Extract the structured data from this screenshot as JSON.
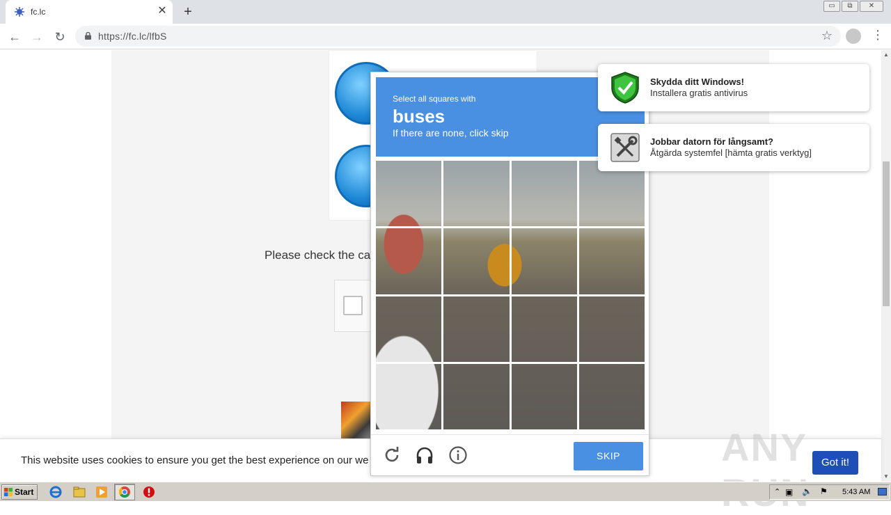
{
  "tab": {
    "title": "fc.lc",
    "close": "✕",
    "new_tab": "+"
  },
  "window": {
    "minimize": "▭",
    "restore": "⧉",
    "close": "✕"
  },
  "toolbar": {
    "url": "https://fc.lc/lfbS"
  },
  "page": {
    "please_text": "Please check the ca",
    "cookie_text": "This website uses cookies to ensure you get the best experience on our we",
    "got_it": "Got it!",
    "watermark": "ANY RUN"
  },
  "captcha": {
    "instruction": "Select all squares with",
    "target": "buses",
    "subtext": "If there are none, click skip",
    "skip_label": "SKIP",
    "icons": [
      "reload-icon",
      "audio-icon",
      "info-icon"
    ]
  },
  "notifications": [
    {
      "title": "Skydda ditt Windows!",
      "body": "Installera gratis antivirus",
      "icon": "shield-check-icon"
    },
    {
      "title": "Jobbar datorn för långsamt?",
      "body": "Åtgärda systemfel [hämta gratis verktyg]",
      "icon": "tools-icon"
    }
  ],
  "taskbar": {
    "start_label": "Start",
    "clock": "5:43 AM",
    "items": [
      "ie-icon",
      "explorer-icon",
      "media-player-icon",
      "chrome-icon",
      "stop-icon"
    ]
  },
  "colors": {
    "captcha_blue": "#4a90e2",
    "got_it_blue": "#1e4eb8",
    "shield_green": "#2eb82e"
  }
}
